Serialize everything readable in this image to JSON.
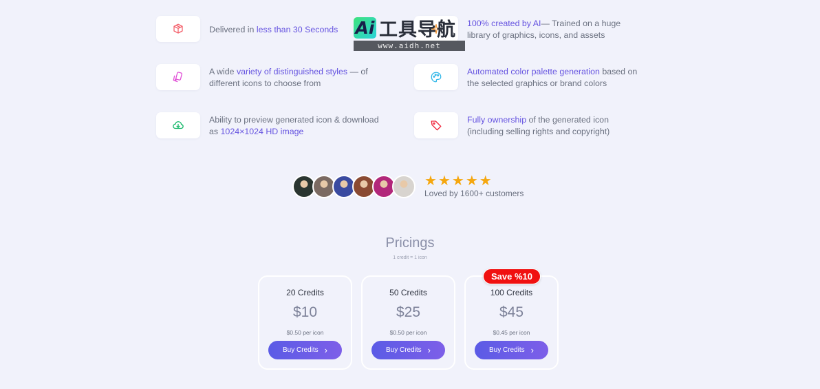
{
  "watermark": {
    "logo": "Ai",
    "name": "工具导航",
    "url": "www.aidh.net"
  },
  "features": [
    {
      "icon": "box-icon",
      "color": "#f4606b",
      "pre": "Delivered in ",
      "hl": "less than 30 Seconds",
      "post": ""
    },
    {
      "icon": "sparkle-icon",
      "color": "#f49a3a",
      "pre": "",
      "hl": "100% created by AI",
      "post": "— Trained on a huge library of graphics, icons, and assets"
    },
    {
      "icon": "shapes-icon",
      "color": "#e04fd6",
      "pre": "A wide ",
      "hl": "variety of distinguished styles",
      "post": " — of different icons to choose from"
    },
    {
      "icon": "palette-icon",
      "color": "#2eb6e8",
      "pre": "",
      "hl": "Automated color palette generation",
      "post": " based on the selected graphics or brand colors"
    },
    {
      "icon": "cloud-download-icon",
      "color": "#16b86a",
      "pre": "Ability to preview generated icon & download as ",
      "hl": "1024×1024 HD image",
      "post": ""
    },
    {
      "icon": "tag-icon",
      "color": "#f0273d",
      "pre": "",
      "hl": "Fully ownership",
      "post": " of the generated icon (including selling rights and copyright)"
    }
  ],
  "social": {
    "rating": 5,
    "star": "★",
    "loved": "Loved by 1600+ customers",
    "avatar_colors": [
      "#2a3530",
      "#7b6a62",
      "#3a4aa0",
      "#8a4a32",
      "#b2277a",
      "#d8d4cf"
    ]
  },
  "pricing": {
    "title": "Pricings",
    "subtitle": "1 credit = 1 icon",
    "badge": "Save %10",
    "plans": [
      {
        "credits": "20 Credits",
        "price": "$10",
        "per": "$0.50 per icon",
        "button": "Buy Credits"
      },
      {
        "credits": "50 Credits",
        "price": "$25",
        "per": "$0.50 per icon",
        "button": "Buy Credits"
      },
      {
        "credits": "100 Credits",
        "price": "$45",
        "per": "$0.45 per icon",
        "button": "Buy Credits"
      }
    ],
    "chevron": "›",
    "accent": "#6553e0"
  }
}
